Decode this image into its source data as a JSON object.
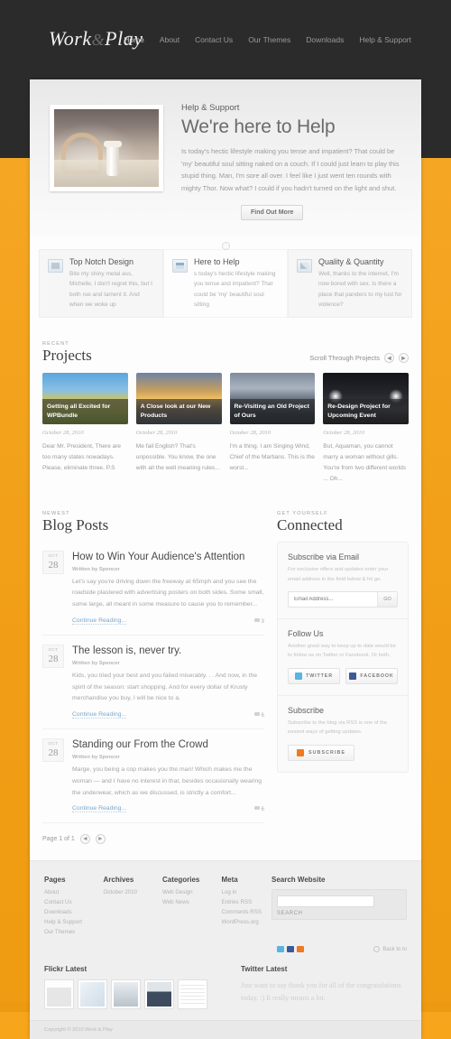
{
  "site": {
    "logo_main": "Work",
    "logo_amp": "&",
    "logo_second": "Play"
  },
  "nav": {
    "items": [
      {
        "label": "Home",
        "active": true
      },
      {
        "label": "About",
        "active": false
      },
      {
        "label": "Contact Us",
        "active": false
      },
      {
        "label": "Our Themes",
        "active": false
      },
      {
        "label": "Downloads",
        "active": false
      },
      {
        "label": "Help & Support",
        "active": false
      }
    ]
  },
  "hero": {
    "kicker": "Help & Support",
    "title": "We're here to Help",
    "body": "Is today's hectic lifestyle making you tense and impatient? That could be 'my' beautiful soul sitting naked on a couch. If I could just learn to play this stupid thing. Man, I'm sore all over. I feel like I just went ten rounds with mighty Thor. Now what? I could if you hadn't turned on the light and shut.",
    "button": "Find Out More"
  },
  "features": [
    {
      "title": "Top Notch Design",
      "body": "Bite my shiny metal ass, Michelle, I don't regret this, but I both rue and lament it. And when we woke up"
    },
    {
      "title": "Here to Help",
      "body": "s today's hectic lifestyle making you tense and impatient? That could be 'my' beautiful soul sitting"
    },
    {
      "title": "Quality & Quantity",
      "body": "Well, thanks to the internet, I'm now bored with sex. Is there a place that panders to my lust for violence?"
    }
  ],
  "projects": {
    "kicker": "RECENT",
    "title": "Projects",
    "scroll_label": "Scroll Through Projects",
    "prev": "◄",
    "next": "►",
    "items": [
      {
        "caption": "Getting all Excited for WPBundle",
        "date": "October 28, 2010",
        "body": "Dear Mr. President, There are too many states nowadays. Please, eliminate three. P.S"
      },
      {
        "caption": "A Close look at our New Products",
        "date": "October 28, 2010",
        "body": "Me fail English? That's unpossible. You know, the one with all the well meaning rules..."
      },
      {
        "caption": "Re-Visiting an Old Project of Ours",
        "date": "October 28, 2010",
        "body": "I'm a thing. I am Singing Wind, Chief of the Martians. This is the worst..."
      },
      {
        "caption": "Re-Design Project for Upcoming Event",
        "date": "October 28, 2010",
        "body": "But, Aquaman, you cannot marry a woman without gills. You're from two different worlds ... Oh..."
      }
    ]
  },
  "blog": {
    "kicker": "NEWEST",
    "title": "Blog Posts",
    "posts": [
      {
        "month": "OCT",
        "day": "28",
        "title": "How to Win Your Audience's Attention",
        "meta": "Written by Spencer",
        "body": "Let's say you're driving down the freeway at 65mph and you see the roadside plastered with advertising posters on both sides. Some small, some large, all meant in some measure to cause you to remember...",
        "more": "Continue Reading...",
        "comments": "3"
      },
      {
        "month": "OCT",
        "day": "28",
        "title": "The lesson is, never try.",
        "meta": "Written by Spencer",
        "body": "Kids, you tried your best and you failed miserably. . . And now, in the spirit of the season: start shopping. And for every dollar of Krusty merchandise you buy, I will be nice to a.",
        "more": "Continue Reading...",
        "comments": "6"
      },
      {
        "month": "OCT",
        "day": "28",
        "title": "Standing our From the Crowd",
        "meta": "Written by Spencer",
        "body": "Marge, you being a cop makes you the man! Which makes me the woman — and I have no interest in that, besides occasionally wearing the underwear, which as we discussed, is strictly a comfort...",
        "more": "Continue Reading...",
        "comments": "6"
      }
    ],
    "pager_label": "Page 1 of 1",
    "pager_prev": "◄",
    "pager_next": "►"
  },
  "sidebar": {
    "kicker": "GET YOURSELF",
    "title": "Connected",
    "subscribe_email": {
      "title": "Subscribe via Email",
      "desc": "For exclusive offers and updates enter your email address in the field below & hit go.",
      "placeholder": "Email Address...",
      "button": "GO"
    },
    "follow": {
      "title": "Follow Us",
      "desc": "Another great way to keep up to date would be to follow us on Twitter or Facebook. Or both.",
      "twitter": "TWITTER",
      "facebook": "FACEBOOK"
    },
    "subscribe_rss": {
      "title": "Subscribe",
      "desc": "Subscribe to the blog via RSS is one of the easiest ways of getting updates.",
      "button": "SUBSCRIBE"
    }
  },
  "footer": {
    "columns": [
      {
        "heading": "Pages",
        "links": [
          "About",
          "Contact Us",
          "Downloads",
          "Help & Support",
          "Our Themes"
        ]
      },
      {
        "heading": "Archives",
        "links": [
          "October 2010"
        ]
      },
      {
        "heading": "Categories",
        "links": [
          "Web Design",
          "Web News"
        ]
      },
      {
        "heading": "Meta",
        "links": [
          "Log in",
          "Entries RSS",
          "Comments RSS",
          "WordPress.org"
        ]
      }
    ],
    "search": {
      "heading": "Search Website",
      "value": "",
      "label": "SEARCH"
    },
    "back_to_top": "Back to to",
    "flickr": {
      "heading": "Flickr Latest"
    },
    "twitter": {
      "heading": "Twitter Latest",
      "text": "Just want to say thank you for all of the congratulations today. :) It really means a lot."
    },
    "copyright": "Copyright © 2010 Work & Play"
  },
  "colors": {
    "accent_orange": "#f5a623",
    "header_dark": "#2b2b2b",
    "link_blue": "#7aa7cf",
    "twitter_blue": "#57b4e4",
    "facebook_blue": "#3b5998",
    "rss_orange": "#ef7a20"
  }
}
